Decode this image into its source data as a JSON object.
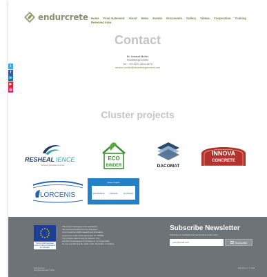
{
  "brand": {
    "name": "endurcrete",
    "logo_icon": "diamond-leaf-icon",
    "accent": "#6a8a3a"
  },
  "nav": {
    "items": [
      "Home",
      "Final statement",
      "About",
      "News",
      "Events",
      "Documents",
      "Gallery",
      "Videos",
      "Cooperation",
      "Training",
      "Reserved Area"
    ]
  },
  "social": {
    "icons": [
      "twitter-icon",
      "facebook-icon",
      "linkedin-icon",
      "youtube-icon",
      "instagram-icon"
    ],
    "glyphs": [
      "t",
      "f",
      "in",
      "▶",
      "◎"
    ]
  },
  "contact": {
    "title": "Contact",
    "name": "Dr. Arnaud Muller",
    "company": "HeidelbergCement",
    "phone": "Tel.: +49 6221 4811 3676",
    "email": "arnaud.muller@heidelbergcement.com"
  },
  "cluster": {
    "title": "Cluster projects",
    "resheal": {
      "part1": "RESHEAL",
      "part2": "IENCE",
      "tagline": "Enhancing Durable Concrete"
    },
    "eco": {
      "line1": "ECO",
      "line2": "BINDER"
    },
    "dacomat": {
      "name": "DACOMAT"
    },
    "innova": {
      "line1": "INNOVA",
      "line2": "CONCRETE"
    },
    "lorcenis": {
      "name": "LORCENIS"
    },
    "banner": {
      "heading": "Cluster Projects",
      "p1": "ENDURCRETE",
      "p2": "LORCENIS",
      "p3": "ECOBINDER"
    }
  },
  "footer": {
    "eu_caption": "Horizon 2020 European Union Funding for Research & Innovation",
    "eu_text": [
      "This project belonging to the application",
      "has received funding from the European",
      "Union's Horizon 2020 research and innovation",
      "programme under grant agreement No 760639.",
      "This website reflects only the author's view",
      "and that the European Commission is not responsible",
      "for any use that may be made of the information it contains."
    ],
    "subscribe_title": "Subscribe Newsletter",
    "subscribe_desc": "Subscribe our newsletter and get the latest project news",
    "email_placeholder": "your@email.com",
    "subscribe_button": "Subscribe",
    "copyright_line1": "endurcrete.eu",
    "copyright_line2": "All rights reserved © 2024",
    "credit": "Web PG s.r.l. © 2024"
  }
}
